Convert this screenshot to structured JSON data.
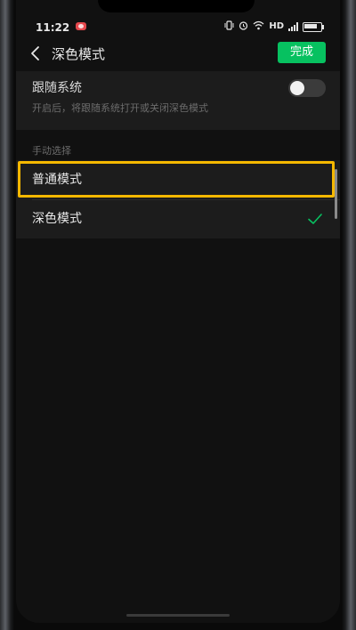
{
  "status_bar": {
    "time": "11:22",
    "network": "HD",
    "icons": [
      "recording-icon",
      "vibrate-icon",
      "alarm-icon",
      "wifi-icon",
      "signal-icon",
      "battery-icon"
    ]
  },
  "header": {
    "title": "深色模式",
    "done_label": "完成",
    "back_icon": "chevron-left-icon"
  },
  "follow_system": {
    "title": "跟随系统",
    "description": "开启后，将跟随系统打开或关闭深色模式",
    "enabled": false
  },
  "manual": {
    "section_label": "手动选择",
    "options": [
      {
        "label": "普通模式",
        "selected": false,
        "highlighted": true
      },
      {
        "label": "深色模式",
        "selected": true,
        "highlighted": false
      }
    ]
  },
  "colors": {
    "accent": "#07c160",
    "highlight": "#f5b800",
    "background": "#111111",
    "card": "#1c1c1c"
  }
}
